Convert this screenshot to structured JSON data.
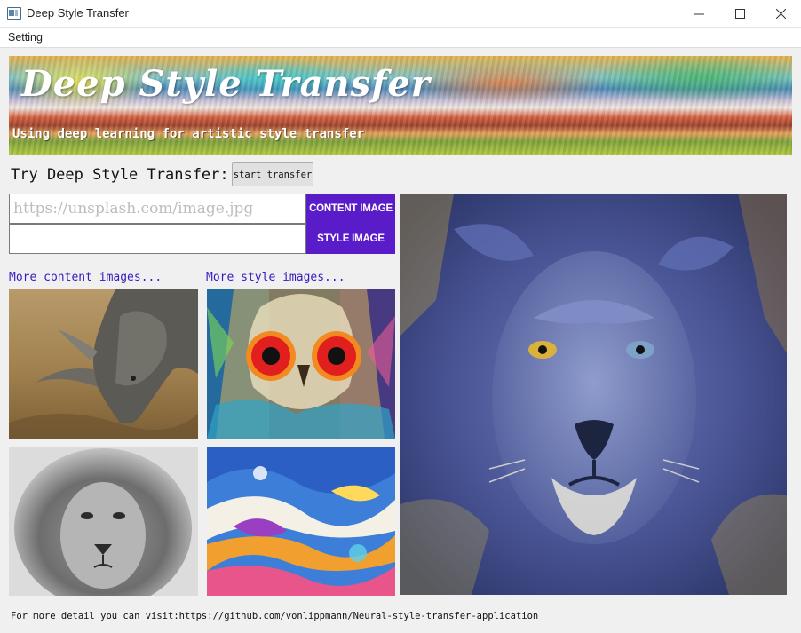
{
  "window": {
    "title": "Deep Style Transfer",
    "icon": "app-window-icon"
  },
  "menubar": {
    "items": [
      "Setting"
    ]
  },
  "banner": {
    "title": "Deep Style Transfer",
    "subtitle": "Using deep learning for artistic style transfer"
  },
  "try": {
    "label": "Try Deep Style Transfer:",
    "start_button": "start transfer"
  },
  "inputs": {
    "content_placeholder": "https://unsplash.com/image.jpg",
    "content_value": "",
    "style_placeholder": "",
    "style_value": "",
    "content_button": "CONTENT IMAGE",
    "style_button": "STYLE IMAGE"
  },
  "links": {
    "more_content": "More content images...",
    "more_style": "More style images..."
  },
  "thumbnails": {
    "content": [
      "rhino-photo",
      "lion-bw-photo"
    ],
    "style": [
      "owl-painting",
      "fluid-art"
    ]
  },
  "result": {
    "image": "stylized-lion"
  },
  "footer": {
    "text": "For more detail you can visit:https://github.com/vonlippmann/Neural-style-transfer-application"
  },
  "colors": {
    "accent_button": "#5a1cc9",
    "link": "#3a1ac0",
    "window_bg": "#f0f0f0"
  }
}
